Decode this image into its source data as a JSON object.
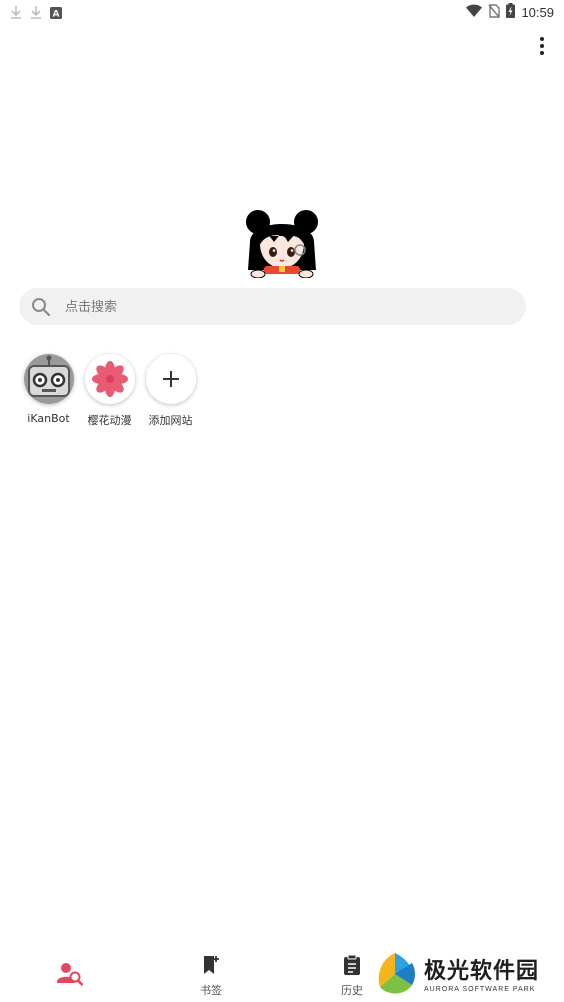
{
  "status_bar": {
    "left_icons": [
      "download-icon",
      "download-icon",
      "keyboard-a-icon"
    ],
    "right_icons": [
      "wifi-icon",
      "no-sim-icon",
      "battery-charging-icon"
    ],
    "time": "10:59"
  },
  "top_bar": {
    "menu_icon": "more-vert-icon"
  },
  "search": {
    "placeholder": "点击搜索",
    "value": ""
  },
  "shortcuts": [
    {
      "label": "iKanBot",
      "icon": "robot-icon"
    },
    {
      "label": "樱花动漫",
      "icon": "sakura-flower-icon"
    },
    {
      "label": "添加网站",
      "icon": "plus-icon"
    }
  ],
  "bottom_nav": [
    {
      "label": "",
      "icon": "user-search-icon",
      "active": true
    },
    {
      "label": "书签",
      "icon": "bookmark-icon"
    },
    {
      "label": "历史",
      "icon": "clipboard-history-icon"
    }
  ],
  "watermark": {
    "title": "极光软件园",
    "subtitle": "AURORA SOFTWARE PARK"
  },
  "colors": {
    "accent": "#e5455e",
    "search_bg": "#f1f1f1",
    "flower": "#e85b73"
  }
}
